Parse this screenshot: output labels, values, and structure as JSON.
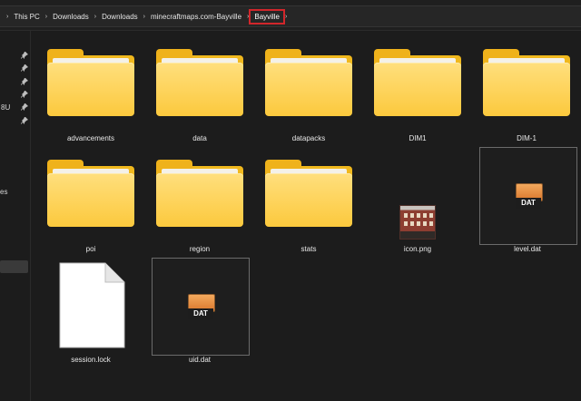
{
  "address_bar": {
    "crumbs": [
      "This PC",
      "Downloads",
      "Downloads",
      "minecraftmaps.com-Bayville",
      "Bayville"
    ],
    "separator": "›"
  },
  "sidebar": {
    "fragments": [
      "8U",
      "es"
    ]
  },
  "files": [
    {
      "name": "advancements",
      "type": "folder"
    },
    {
      "name": "data",
      "type": "folder"
    },
    {
      "name": "datapacks",
      "type": "folder"
    },
    {
      "name": "DIM1",
      "type": "folder"
    },
    {
      "name": "DIM-1",
      "type": "folder"
    },
    {
      "name": "poi",
      "type": "folder"
    },
    {
      "name": "region",
      "type": "folder"
    },
    {
      "name": "stats",
      "type": "folder"
    },
    {
      "name": "icon.png",
      "type": "image"
    },
    {
      "name": "level.dat",
      "type": "dat",
      "icon_text": "DAT"
    },
    {
      "name": "session.lock",
      "type": "blank-file"
    },
    {
      "name": "uid.dat",
      "type": "dat",
      "icon_text": "DAT"
    }
  ],
  "colors": {
    "background": "#1c1c1c",
    "folder": "#f9c63a",
    "highlight_box": "#d1262b"
  }
}
